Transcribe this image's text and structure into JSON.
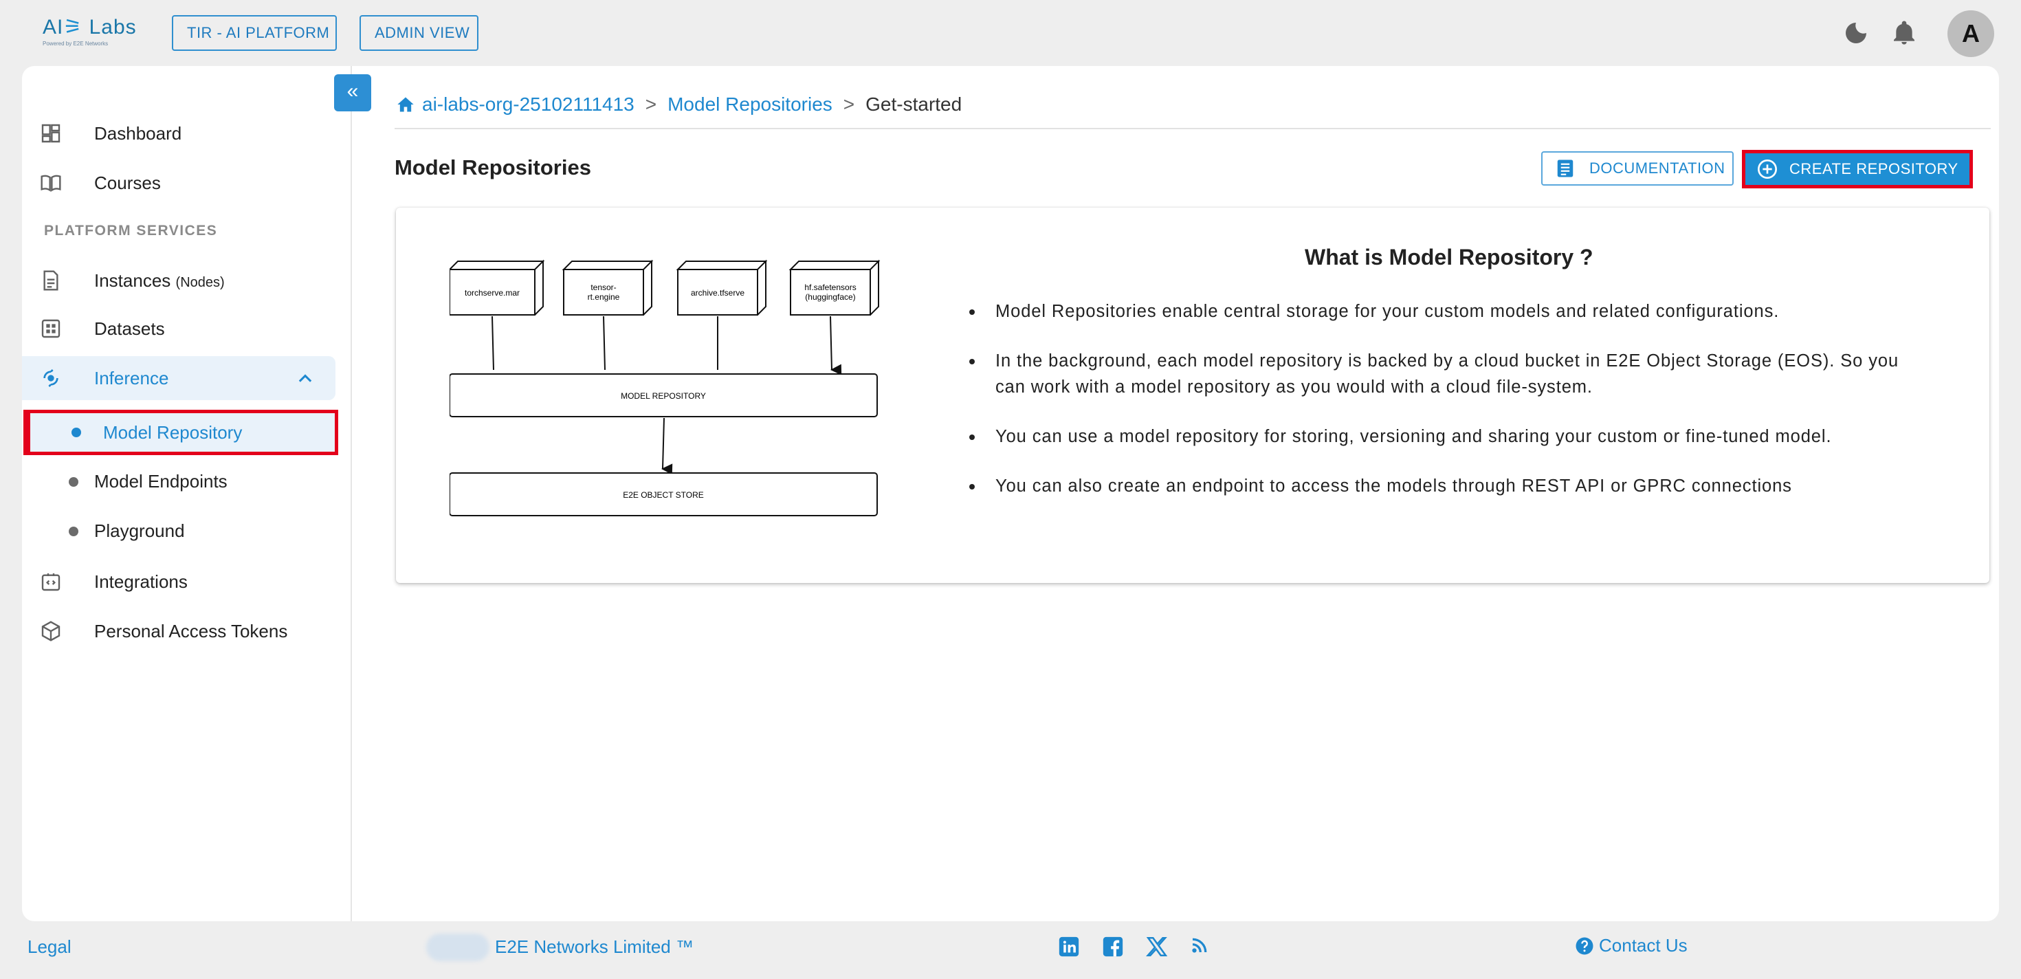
{
  "header": {
    "logo_text_a": "AI",
    "logo_text_b": "Labs",
    "logo_sub": "Powered by E2E Networks",
    "platform_chip": "TIR - AI PLATFORM",
    "admin_chip": "ADMIN VIEW",
    "avatar_letter": "A"
  },
  "sidebar": {
    "dashboard": "Dashboard",
    "courses": "Courses",
    "section_title": "PLATFORM SERVICES",
    "instances": "Instances",
    "instances_suffix": "(Nodes)",
    "datasets": "Datasets",
    "inference": "Inference",
    "sub_items": [
      "Model Repository",
      "Model Endpoints",
      "Playground"
    ],
    "integrations": "Integrations",
    "tokens": "Personal Access Tokens",
    "collapse_glyph": "«"
  },
  "breadcrumb": {
    "org": "ai-labs-org-25102111413",
    "section": "Model Repositories",
    "current": "Get-started",
    "separator": ">"
  },
  "page": {
    "title": "Model Repositories",
    "documentation_button": "DOCUMENTATION",
    "create_button": "CREATE REPOSITORY"
  },
  "card": {
    "title": "What is Model Repository ?",
    "bullets": [
      "Model Repositories enable central storage for your custom models and related configurations.",
      "In the background, each model repository is backed by a cloud bucket in E2E Object Storage (EOS). So you can work with a model repository as you would with a cloud file-system.",
      "You can use a model repository for storing, versioning and sharing your custom or fine-tuned model.",
      "You can also create an endpoint to access the models through REST API or GPRC connections"
    ],
    "diagram": {
      "boxes": [
        "torchserve.mar",
        "tensor-\nrt.engine",
        "archive.tfserve",
        "hf.safetensors\n(huggingface)"
      ],
      "repository": "MODEL REPOSITORY",
      "store": "E2E OBJECT STORE"
    }
  },
  "footer": {
    "legal": "Legal",
    "company": "E2E Networks Limited ™",
    "contact": "Contact Us"
  },
  "colors": {
    "accent": "#1e88cf",
    "highlight": "#e3001b",
    "background": "#eeeeee"
  }
}
